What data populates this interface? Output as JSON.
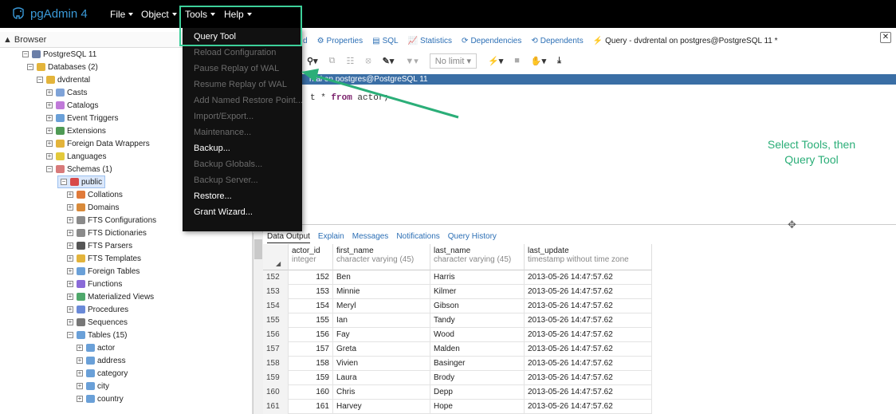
{
  "app": {
    "title": "pgAdmin 4"
  },
  "menubar": {
    "items": [
      {
        "label": "File"
      },
      {
        "label": "Object"
      },
      {
        "label": "Tools"
      },
      {
        "label": "Help"
      }
    ]
  },
  "tools_menu": {
    "items": [
      {
        "label": "Query Tool",
        "enabled": true
      },
      {
        "label": "Reload Configuration",
        "enabled": false
      },
      {
        "label": "Pause Replay of WAL",
        "enabled": false
      },
      {
        "label": "Resume Replay of WAL",
        "enabled": false
      },
      {
        "label": "Add Named Restore Point...",
        "enabled": false
      },
      {
        "label": "Import/Export...",
        "enabled": false
      },
      {
        "label": "Maintenance...",
        "enabled": false
      },
      {
        "label": "Backup...",
        "enabled": true
      },
      {
        "label": "Backup Globals...",
        "enabled": false
      },
      {
        "label": "Backup Server...",
        "enabled": false
      },
      {
        "label": "Restore...",
        "enabled": true
      },
      {
        "label": "Grant Wizard...",
        "enabled": true
      }
    ]
  },
  "browser": {
    "title": "Browser",
    "tree": [
      {
        "label": "PostgreSQL 11",
        "icon": "server-icon"
      },
      {
        "label": "Databases (2)",
        "icon": "databases-icon"
      },
      {
        "label": "dvdrental",
        "icon": "database-icon"
      },
      {
        "label": "Casts",
        "icon": "casts-icon"
      },
      {
        "label": "Catalogs",
        "icon": "catalogs-icon"
      },
      {
        "label": "Event Triggers",
        "icon": "event-triggers-icon"
      },
      {
        "label": "Extensions",
        "icon": "extensions-icon"
      },
      {
        "label": "Foreign Data Wrappers",
        "icon": "fdw-icon"
      },
      {
        "label": "Languages",
        "icon": "languages-icon"
      },
      {
        "label": "Schemas (1)",
        "icon": "schemas-icon"
      },
      {
        "label": "public",
        "icon": "schema-icon"
      },
      {
        "label": "Collations",
        "icon": "collations-icon"
      },
      {
        "label": "Domains",
        "icon": "domains-icon"
      },
      {
        "label": "FTS Configurations",
        "icon": "fts-config-icon"
      },
      {
        "label": "FTS Dictionaries",
        "icon": "fts-dict-icon"
      },
      {
        "label": "FTS Parsers",
        "icon": "fts-parser-icon"
      },
      {
        "label": "FTS Templates",
        "icon": "fts-template-icon"
      },
      {
        "label": "Foreign Tables",
        "icon": "foreign-table-icon"
      },
      {
        "label": "Functions",
        "icon": "functions-icon"
      },
      {
        "label": "Materialized Views",
        "icon": "mview-icon"
      },
      {
        "label": "Procedures",
        "icon": "procedures-icon"
      },
      {
        "label": "Sequences",
        "icon": "sequences-icon"
      },
      {
        "label": "Tables (15)",
        "icon": "tables-icon"
      },
      {
        "label": "actor",
        "icon": "table-icon"
      },
      {
        "label": "address",
        "icon": "table-icon"
      },
      {
        "label": "category",
        "icon": "table-icon"
      },
      {
        "label": "city",
        "icon": "table-icon"
      },
      {
        "label": "country",
        "icon": "table-icon"
      }
    ]
  },
  "tabs": [
    {
      "label": "d",
      "icon": "dashboard-icon"
    },
    {
      "label": "Properties",
      "icon": "properties-icon"
    },
    {
      "label": "SQL",
      "icon": "sql-icon"
    },
    {
      "label": "Statistics",
      "icon": "statistics-icon"
    },
    {
      "label": "Dependencies",
      "icon": "dependencies-icon"
    },
    {
      "label": "Dependents",
      "icon": "dependents-icon"
    },
    {
      "label": "Query - dvdrental on postgres@PostgreSQL 11 *",
      "icon": "query-icon"
    }
  ],
  "toolbar": {
    "no_limit": "No limit"
  },
  "query": {
    "connection": "ntal on postgres@PostgreSQL 11",
    "sql_prefix": "t ",
    "sql_star": "* ",
    "sql_from": "from",
    "sql_rest": " actor;"
  },
  "annotation": {
    "line1": "Select Tools, then",
    "line2": "Query Tool"
  },
  "results": {
    "tabs": [
      "Data Output",
      "Explain",
      "Messages",
      "Notifications",
      "Query History"
    ],
    "columns": [
      {
        "name": "actor_id",
        "type": "integer"
      },
      {
        "name": "first_name",
        "type": "character varying (45)"
      },
      {
        "name": "last_name",
        "type": "character varying (45)"
      },
      {
        "name": "last_update",
        "type": "timestamp without time zone"
      }
    ],
    "rows": [
      [
        "152",
        "152",
        "Ben",
        "Harris",
        "2013-05-26 14:47:57.62"
      ],
      [
        "153",
        "153",
        "Minnie",
        "Kilmer",
        "2013-05-26 14:47:57.62"
      ],
      [
        "154",
        "154",
        "Meryl",
        "Gibson",
        "2013-05-26 14:47:57.62"
      ],
      [
        "155",
        "155",
        "Ian",
        "Tandy",
        "2013-05-26 14:47:57.62"
      ],
      [
        "156",
        "156",
        "Fay",
        "Wood",
        "2013-05-26 14:47:57.62"
      ],
      [
        "157",
        "157",
        "Greta",
        "Malden",
        "2013-05-26 14:47:57.62"
      ],
      [
        "158",
        "158",
        "Vivien",
        "Basinger",
        "2013-05-26 14:47:57.62"
      ],
      [
        "159",
        "159",
        "Laura",
        "Brody",
        "2013-05-26 14:47:57.62"
      ],
      [
        "160",
        "160",
        "Chris",
        "Depp",
        "2013-05-26 14:47:57.62"
      ],
      [
        "161",
        "161",
        "Harvey",
        "Hope",
        "2013-05-26 14:47:57.62"
      ]
    ]
  },
  "colors": {
    "highlight": "#3dd09a",
    "annotation": "#2bae78",
    "link": "#2c6fb5",
    "query_header": "#3a6ea5"
  }
}
